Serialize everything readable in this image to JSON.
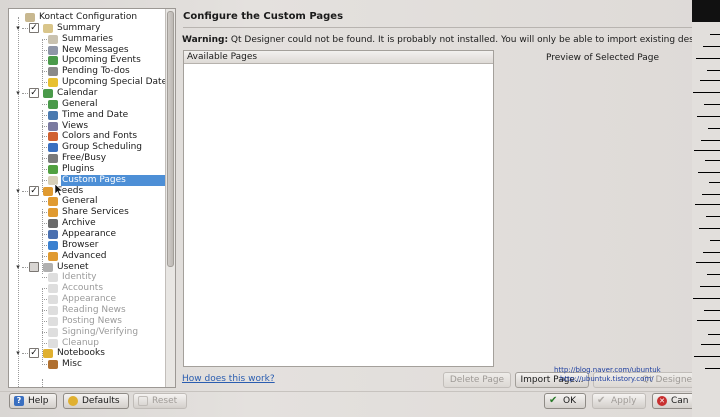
{
  "tree": {
    "items": [
      {
        "label": "Kontact Configuration",
        "level": 0,
        "icon": "folder-config-icon",
        "color": "#c8b890",
        "expander": "",
        "checkbox": null,
        "state": "normal"
      },
      {
        "label": "Summary",
        "level": 1,
        "icon": "summary-icon",
        "color": "#d9c58a",
        "expander": "▾",
        "checkbox": "✓",
        "state": "normal"
      },
      {
        "label": "Summaries",
        "level": 2,
        "icon": "summaries-icon",
        "color": "#c9c2b0",
        "expander": "",
        "checkbox": null,
        "state": "normal"
      },
      {
        "label": "New Messages",
        "level": 2,
        "icon": "new-messages-icon",
        "color": "#8f96a8",
        "expander": "",
        "checkbox": null,
        "state": "normal"
      },
      {
        "label": "Upcoming Events",
        "level": 2,
        "icon": "upcoming-events-icon",
        "color": "#4a9a4a",
        "expander": "",
        "checkbox": null,
        "state": "normal"
      },
      {
        "label": "Pending To-dos",
        "level": 2,
        "icon": "pending-todos-icon",
        "color": "#8a8a8a",
        "expander": "",
        "checkbox": null,
        "state": "normal"
      },
      {
        "label": "Upcoming Special Dates",
        "level": 2,
        "icon": "special-dates-icon",
        "color": "#e8c030",
        "expander": "",
        "checkbox": null,
        "state": "normal"
      },
      {
        "label": "Calendar",
        "level": 1,
        "icon": "calendar-icon",
        "color": "#4a9a4a",
        "expander": "▾",
        "checkbox": "✓",
        "state": "normal"
      },
      {
        "label": "General",
        "level": 2,
        "icon": "general-icon",
        "color": "#4a9a4a",
        "expander": "",
        "checkbox": null,
        "state": "normal"
      },
      {
        "label": "Time and Date",
        "level": 2,
        "icon": "time-date-icon",
        "color": "#4a7ab0",
        "expander": "",
        "checkbox": null,
        "state": "normal"
      },
      {
        "label": "Views",
        "level": 2,
        "icon": "views-icon",
        "color": "#7a7aa0",
        "expander": "",
        "checkbox": null,
        "state": "normal"
      },
      {
        "label": "Colors and Fonts",
        "level": 2,
        "icon": "colors-fonts-icon",
        "color": "#d06030",
        "expander": "",
        "checkbox": null,
        "state": "normal"
      },
      {
        "label": "Group Scheduling",
        "level": 2,
        "icon": "group-scheduling-icon",
        "color": "#3a70c0",
        "expander": "",
        "checkbox": null,
        "state": "normal"
      },
      {
        "label": "Free/Busy",
        "level": 2,
        "icon": "free-busy-icon",
        "color": "#7a7a7a",
        "expander": "",
        "checkbox": null,
        "state": "normal"
      },
      {
        "label": "Plugins",
        "level": 2,
        "icon": "plugins-icon",
        "color": "#50a040",
        "expander": "",
        "checkbox": null,
        "state": "normal"
      },
      {
        "label": "Custom Pages",
        "level": 2,
        "icon": "custom-pages-icon",
        "color": "#d8d0b8",
        "expander": "",
        "checkbox": null,
        "state": "selected"
      },
      {
        "label": "Feeds",
        "level": 1,
        "icon": "feeds-icon",
        "color": "#e09a30",
        "expander": "▾",
        "checkbox": "✓",
        "state": "normal"
      },
      {
        "label": "General",
        "level": 2,
        "icon": "general-feeds-icon",
        "color": "#e09a30",
        "expander": "",
        "checkbox": null,
        "state": "normal"
      },
      {
        "label": "Share Services",
        "level": 2,
        "icon": "share-services-icon",
        "color": "#e09a30",
        "expander": "",
        "checkbox": null,
        "state": "normal"
      },
      {
        "label": "Archive",
        "level": 2,
        "icon": "archive-icon",
        "color": "#6a6a6a",
        "expander": "",
        "checkbox": null,
        "state": "normal"
      },
      {
        "label": "Appearance",
        "level": 2,
        "icon": "appearance-icon",
        "color": "#4a70b0",
        "expander": "",
        "checkbox": null,
        "state": "normal"
      },
      {
        "label": "Browser",
        "level": 2,
        "icon": "browser-icon",
        "color": "#3a80d0",
        "expander": "",
        "checkbox": null,
        "state": "normal"
      },
      {
        "label": "Advanced",
        "level": 2,
        "icon": "advanced-icon",
        "color": "#e09a30",
        "expander": "",
        "checkbox": null,
        "state": "normal"
      },
      {
        "label": "Usenet",
        "level": 1,
        "icon": "usenet-icon",
        "color": "#b0b0b0",
        "expander": "▾",
        "checkbox": "",
        "state": "normal"
      },
      {
        "label": "Identity",
        "level": 2,
        "icon": "identity-icon",
        "color": "#c8c8c8",
        "expander": "",
        "checkbox": null,
        "state": "disabled"
      },
      {
        "label": "Accounts",
        "level": 2,
        "icon": "accounts-icon",
        "color": "#c8c8c8",
        "expander": "",
        "checkbox": null,
        "state": "disabled"
      },
      {
        "label": "Appearance",
        "level": 2,
        "icon": "usenet-appearance-icon",
        "color": "#c8c8c8",
        "expander": "",
        "checkbox": null,
        "state": "disabled"
      },
      {
        "label": "Reading News",
        "level": 2,
        "icon": "reading-news-icon",
        "color": "#c8c8c8",
        "expander": "",
        "checkbox": null,
        "state": "disabled"
      },
      {
        "label": "Posting News",
        "level": 2,
        "icon": "posting-news-icon",
        "color": "#c8c8c8",
        "expander": "",
        "checkbox": null,
        "state": "disabled"
      },
      {
        "label": "Signing/Verifying",
        "level": 2,
        "icon": "signing-icon",
        "color": "#c8c8c8",
        "expander": "",
        "checkbox": null,
        "state": "disabled"
      },
      {
        "label": "Cleanup",
        "level": 2,
        "icon": "cleanup-icon",
        "color": "#c8c8c8",
        "expander": "",
        "checkbox": null,
        "state": "disabled"
      },
      {
        "label": "Notebooks",
        "level": 1,
        "icon": "notebooks-icon",
        "color": "#e0b030",
        "expander": "▾",
        "checkbox": "✓",
        "state": "normal"
      },
      {
        "label": "Misc",
        "level": 2,
        "icon": "misc-icon",
        "color": "#b07030",
        "expander": "",
        "checkbox": null,
        "state": "normal"
      }
    ]
  },
  "main": {
    "title": "Configure the Custom Pages",
    "warning_bold": "Warning:",
    "warning_text": " Qt Designer could not be found. It is probably not installed. You will only be able to import existing designer",
    "available_header": "Available Pages",
    "preview_label": "Preview of Selected Page",
    "how_link": "How does this work?",
    "delete_label": "Delete Page",
    "import_label": "Import Page...",
    "qt_label": "Qt Designer",
    "url_line1": "http://blog.naver.com/ubuntuk",
    "url_line2": "http://ubuntuk.tistory.com/"
  },
  "bottom": {
    "help_label": "Help",
    "defaults_label": "Defaults",
    "reset_label": "Reset",
    "ok_label": "OK",
    "apply_label": "Apply",
    "cancel_label": "Can"
  },
  "colors": {
    "selection": "#4d8fd6",
    "link": "#2a5db0"
  }
}
